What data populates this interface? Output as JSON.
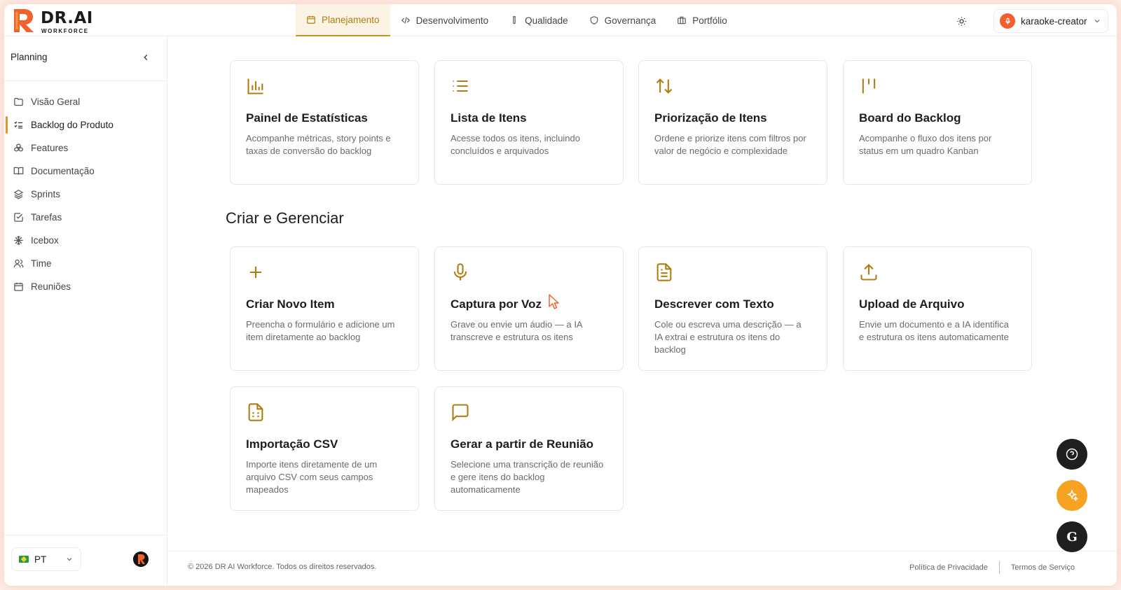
{
  "brand": {
    "name": "DR.AI",
    "subtitle": "WORKFORCE"
  },
  "nav": {
    "tabs": [
      {
        "label": "Planejamento",
        "icon": "calendar-icon",
        "active": true
      },
      {
        "label": "Desenvolvimento",
        "icon": "code-icon"
      },
      {
        "label": "Qualidade",
        "icon": "test-tube-icon"
      },
      {
        "label": "Governança",
        "icon": "shield-icon"
      },
      {
        "label": "Portfólio",
        "icon": "briefcase-icon"
      }
    ],
    "user": "karaoke-creator"
  },
  "sidebar": {
    "title": "Planning",
    "items": [
      {
        "label": "Visão Geral",
        "icon": "folder-icon"
      },
      {
        "label": "Backlog do Produto",
        "icon": "list-checks-icon",
        "active": true
      },
      {
        "label": "Features",
        "icon": "boxes-icon"
      },
      {
        "label": "Documentação",
        "icon": "book-icon"
      },
      {
        "label": "Sprints",
        "icon": "layers-icon"
      },
      {
        "label": "Tarefas",
        "icon": "square-check-icon"
      },
      {
        "label": "Icebox",
        "icon": "snowflake-icon"
      },
      {
        "label": "Time",
        "icon": "users-icon"
      },
      {
        "label": "Reuniões",
        "icon": "calendar-icon"
      }
    ],
    "language": "PT"
  },
  "cards_top": [
    {
      "title": "Painel de Estatísticas",
      "desc": "Acompanhe métricas, story points e taxas de conversão do backlog",
      "icon": "bar-chart-icon"
    },
    {
      "title": "Lista de Itens",
      "desc": "Acesse todos os itens, incluindo concluídos e arquivados",
      "icon": "list-icon"
    },
    {
      "title": "Priorização de Itens",
      "desc": "Ordene e priorize itens com filtros por valor de negócio e complexidade",
      "icon": "arrow-up-down-icon"
    },
    {
      "title": "Board do Backlog",
      "desc": "Acompanhe o fluxo dos itens por status em um quadro Kanban",
      "icon": "kanban-icon"
    }
  ],
  "section": {
    "title": "Criar e Gerenciar"
  },
  "cards_create": [
    {
      "title": "Criar Novo Item",
      "desc": "Preencha o formulário e adicione um item diretamente ao backlog",
      "icon": "plus-icon"
    },
    {
      "title": "Captura por Voz",
      "desc": "Grave ou envie um áudio — a IA transcreve e estrutura os itens",
      "icon": "mic-icon"
    },
    {
      "title": "Descrever com Texto",
      "desc": "Cole ou escreva uma descrição — a IA extrai e estrutura os itens do backlog",
      "icon": "file-text-icon"
    },
    {
      "title": "Upload de Arquivo",
      "desc": "Envie um documento e a IA identifica e estrutura os itens automaticamente",
      "icon": "upload-icon"
    },
    {
      "title": "Importação CSV",
      "desc": "Importe itens diretamente de um arquivo CSV com seus campos mapeados",
      "icon": "file-spreadsheet-icon"
    },
    {
      "title": "Gerar a partir de Reunião",
      "desc": "Selecione uma transcrição de reunião e gere itens do backlog automaticamente",
      "icon": "message-square-icon"
    }
  ],
  "footer": {
    "copyright": "© 2026 DR AI Workforce. Todos os direitos reservados.",
    "privacy": "Política de Privacidade",
    "terms": "Termos de Serviço"
  },
  "fab": {
    "g_label": "G"
  },
  "colors": {
    "accent": "#c8921c",
    "ai_button": "#f5a320",
    "logo": "#f0612e"
  }
}
